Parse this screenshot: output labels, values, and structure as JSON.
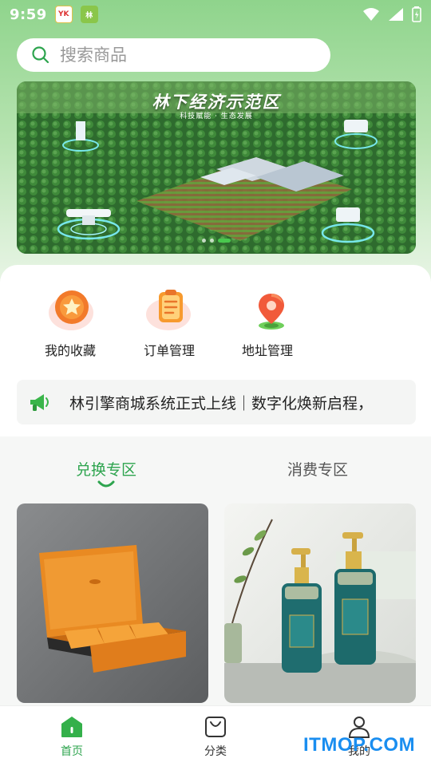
{
  "status_bar": {
    "time": "9:59",
    "app_icon_1": "YK",
    "app_icon_2": "林",
    "icons": [
      "wifi-icon",
      "signal-icon",
      "battery-icon"
    ]
  },
  "search": {
    "placeholder": "搜索商品"
  },
  "banner": {
    "title": "林下经济示范区",
    "subtitle": "科技赋能 · 生态发展",
    "slide_count": 3,
    "active_slide": 1
  },
  "quick_actions": [
    {
      "label": "我的收藏",
      "icon": "star-icon"
    },
    {
      "label": "订单管理",
      "icon": "clipboard-icon"
    },
    {
      "label": "地址管理",
      "icon": "location-pin-icon"
    }
  ],
  "notice": {
    "icon": "megaphone-icon",
    "text": "林引擎商城系统正式上线｜数字化焕新启程，"
  },
  "tabs": [
    {
      "label": "兑换专区",
      "active": true
    },
    {
      "label": "消费专区",
      "active": false
    }
  ],
  "products": [
    {
      "image": "tea-gift-box"
    },
    {
      "image": "shampoo-bottles"
    }
  ],
  "bottom_nav": [
    {
      "label": "首页",
      "icon": "home-icon",
      "active": true
    },
    {
      "label": "分类",
      "icon": "shopping-bag-icon",
      "active": false
    },
    {
      "label": "我的",
      "icon": "user-icon",
      "active": false
    }
  ],
  "watermark": "ITMOP.COM",
  "colors": {
    "accent": "#2da44e",
    "header_gradient_top": "#8fd48c",
    "notice_bg": "#f4f5f4"
  }
}
